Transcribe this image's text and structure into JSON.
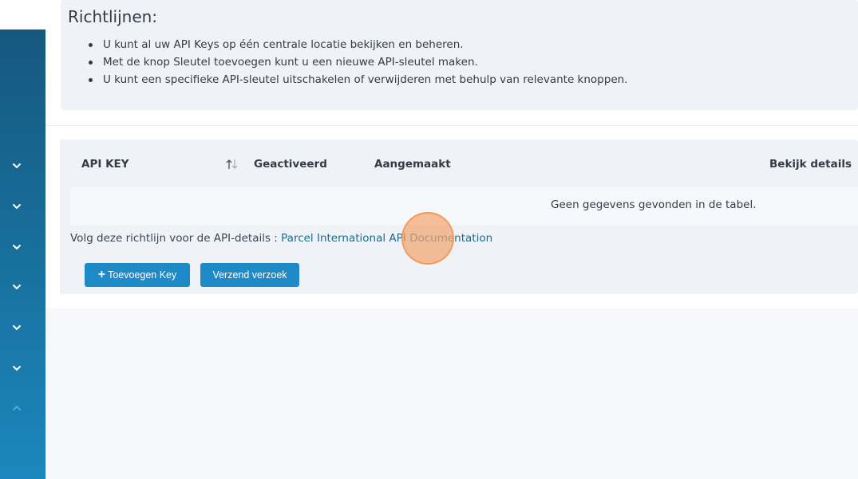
{
  "colors": {
    "sidebar_top": "#15587f",
    "sidebar_bottom": "#1b87bd",
    "button": "#1e8ac8",
    "link": "#1f6a8a",
    "panel": "#eff2f7",
    "cursor": "#f4a46e"
  },
  "sidebar": {
    "icons": [
      "chevron-down-icon",
      "chevron-down-icon",
      "chevron-down-icon",
      "chevron-down-icon",
      "chevron-down-icon",
      "chevron-down-icon",
      "chevron-up-icon"
    ]
  },
  "guidelines": {
    "title": "Richtlijnen:",
    "items": [
      "U kunt al uw API Keys op één centrale locatie bekijken en beheren.",
      "Met de knop Sleutel toevoegen kunt u een nieuwe API-sleutel maken.",
      "U kunt een specifieke API-sleutel uitschakelen of verwijderen met behulp van relevante knoppen."
    ]
  },
  "table": {
    "columns": [
      "API KEY",
      "Geactiveerd",
      "Aangemaakt",
      "Bekijk details"
    ],
    "sort_icon": "sort-icon",
    "empty_message": "Geen gegevens gevonden in de tabel."
  },
  "docs": {
    "prefix": "Volg deze richtlijn voor de API-details : ",
    "link_text": "Parcel International API Documentation"
  },
  "actions": {
    "add_plus": "+",
    "add_label": "Toevoegen Key",
    "send_label": "Verzend verzoek"
  }
}
